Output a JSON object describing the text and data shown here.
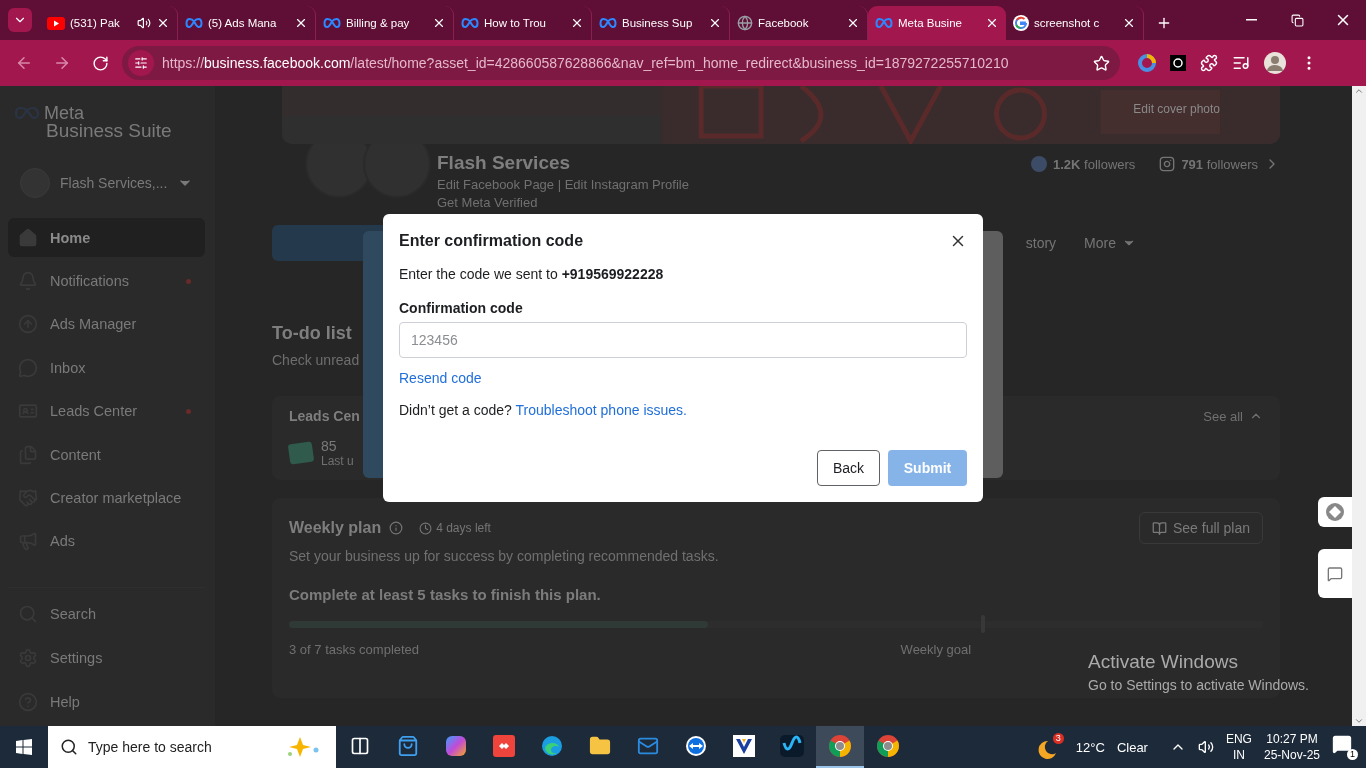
{
  "browser": {
    "tabs": [
      {
        "title": "(531) Pak",
        "kind": "video",
        "audio": true,
        "selected": false
      },
      {
        "title": "(5) Ads Mana",
        "kind": "meta",
        "audio": false,
        "selected": false
      },
      {
        "title": "Billing & pay",
        "kind": "meta",
        "audio": false,
        "selected": false
      },
      {
        "title": "How to Trou",
        "kind": "meta",
        "audio": false,
        "selected": false
      },
      {
        "title": "Business Sup",
        "kind": "meta",
        "audio": false,
        "selected": false
      },
      {
        "title": "Facebook",
        "kind": "globe",
        "audio": false,
        "selected": false
      },
      {
        "title": "Meta Busine",
        "kind": "meta",
        "audio": false,
        "selected": true
      },
      {
        "title": "screenshot c",
        "kind": "google",
        "audio": false,
        "selected": false
      }
    ],
    "url": {
      "scheme": "https://",
      "host": "business.facebook.com",
      "path": "/latest/home?asset_id=428660587628866&nav_ref=bm_home_redirect&business_id=1879272255710210"
    }
  },
  "sidebar": {
    "brand": "Meta",
    "product": "Business Suite",
    "account": "Flash Services,...",
    "items": [
      {
        "label": "Home",
        "kind": "home",
        "selected": true,
        "alert": false
      },
      {
        "label": "Notifications",
        "kind": "bell",
        "selected": false,
        "alert": true
      },
      {
        "label": "Ads Manager",
        "kind": "compass",
        "selected": false,
        "alert": false
      },
      {
        "label": "Inbox",
        "kind": "chat",
        "selected": false,
        "alert": false
      },
      {
        "label": "Leads Center",
        "kind": "card",
        "selected": false,
        "alert": true
      },
      {
        "label": "Content",
        "kind": "files",
        "selected": false,
        "alert": false
      },
      {
        "label": "Creator marketplace",
        "kind": "handshake",
        "selected": false,
        "alert": false
      },
      {
        "label": "Ads",
        "kind": "megaphone",
        "selected": false,
        "alert": false
      }
    ],
    "footer": [
      {
        "label": "Search",
        "kind": "search"
      },
      {
        "label": "Settings",
        "kind": "gear"
      },
      {
        "label": "Help",
        "kind": "help"
      }
    ]
  },
  "profile": {
    "cover_action": "Edit cover photo",
    "name": "Flash Services",
    "links": "Edit Facebook Page | Edit Instagram Profile",
    "verified": "Get Meta Verified",
    "stats": [
      {
        "kind": "facebook",
        "count": "1.2K",
        "label": "followers"
      },
      {
        "kind": "instagram",
        "count": "791",
        "label": "followers"
      }
    ]
  },
  "page_tabs": [
    {
      "label": "story",
      "menu": false
    },
    {
      "label": "More",
      "menu": true
    }
  ],
  "todo": {
    "title": "To-do list",
    "subtitle": "Check unread"
  },
  "leads": {
    "title": "Leads Cen",
    "count": "85",
    "updated": "Last u",
    "see_all": "See all"
  },
  "weekly_plan": {
    "title": "Weekly plan",
    "deadline": "4 days left",
    "description": "Set your business up for success by completing recommended tasks.",
    "button": "See full plan",
    "goal": "Complete at least 5 tasks to finish this plan.",
    "level": 0.43,
    "progress_text": "3 of 7 tasks completed",
    "marker": "Weekly goal"
  },
  "dialog": {
    "title": "Enter confirmation code",
    "message": "Enter the code we sent to **+919569922228**",
    "field_label": "Confirmation code",
    "placeholder": "123456",
    "resend": "Resend code",
    "help_text": "Didn’t get a code?",
    "help_link": "Troubleshoot phone issues.",
    "buttons": [
      {
        "label": "Back",
        "kind": "secondary",
        "disabled": false
      },
      {
        "label": "Submit",
        "kind": "primary",
        "disabled": true
      }
    ]
  },
  "activation": {
    "title": "Activate Windows",
    "text": "Go to Settings to activate Windows."
  },
  "taskbar": {
    "search_placeholder": "Type here to search",
    "apps": [
      {
        "kind": "taskview",
        "active": false
      },
      {
        "kind": "store",
        "active": false
      },
      {
        "kind": "gradient",
        "active": false
      },
      {
        "kind": "diamond",
        "active": false
      },
      {
        "kind": "wave",
        "active": false
      },
      {
        "kind": "folder",
        "active": false
      },
      {
        "kind": "mail",
        "active": false
      },
      {
        "kind": "arrows",
        "active": false
      },
      {
        "kind": "check",
        "active": false
      },
      {
        "kind": "loop",
        "active": false
      },
      {
        "kind": "chrome",
        "active": true
      },
      {
        "kind": "chrome",
        "active": false
      }
    ],
    "weather_badge": "3",
    "temperature": "12°C",
    "condition": "Clear",
    "language": "ENG",
    "region": "IN",
    "time": "10:27 PM",
    "date": "25-Nov-25",
    "notifications": "1"
  }
}
